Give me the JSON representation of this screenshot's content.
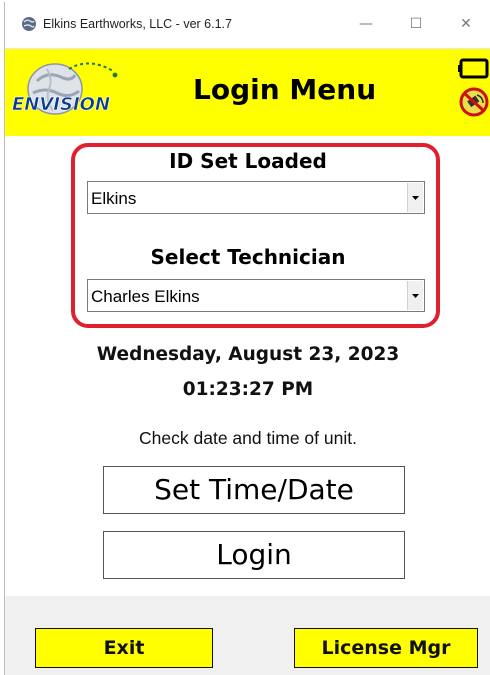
{
  "window": {
    "title": "Elkins Earthworks, LLC - ver 6.1.7",
    "minimize_glyph": "—",
    "maximize_glyph": "☐",
    "close_glyph": "✕"
  },
  "header": {
    "logo_text": "ENVISION",
    "title": "Login Menu",
    "colors": {
      "background": "#ffff00",
      "logo_text": "#0b3c8c"
    },
    "icons": [
      "battery-icon",
      "satellite-disabled-icon"
    ]
  },
  "id_set": {
    "label": "ID Set Loaded",
    "selected": "Elkins"
  },
  "technician": {
    "label": "Select Technician",
    "selected": "Charles Elkins"
  },
  "datetime": {
    "date": "Wednesday, August 23, 2023",
    "time": "01:23:27 PM",
    "hint": "Check date and time of unit."
  },
  "buttons": {
    "set_time_date": "Set Time/Date",
    "login": "Login",
    "exit": "Exit",
    "license_mgr": "License Mgr"
  },
  "colors": {
    "highlight_border": "#e0202e",
    "footer_button": "#ffff00"
  }
}
